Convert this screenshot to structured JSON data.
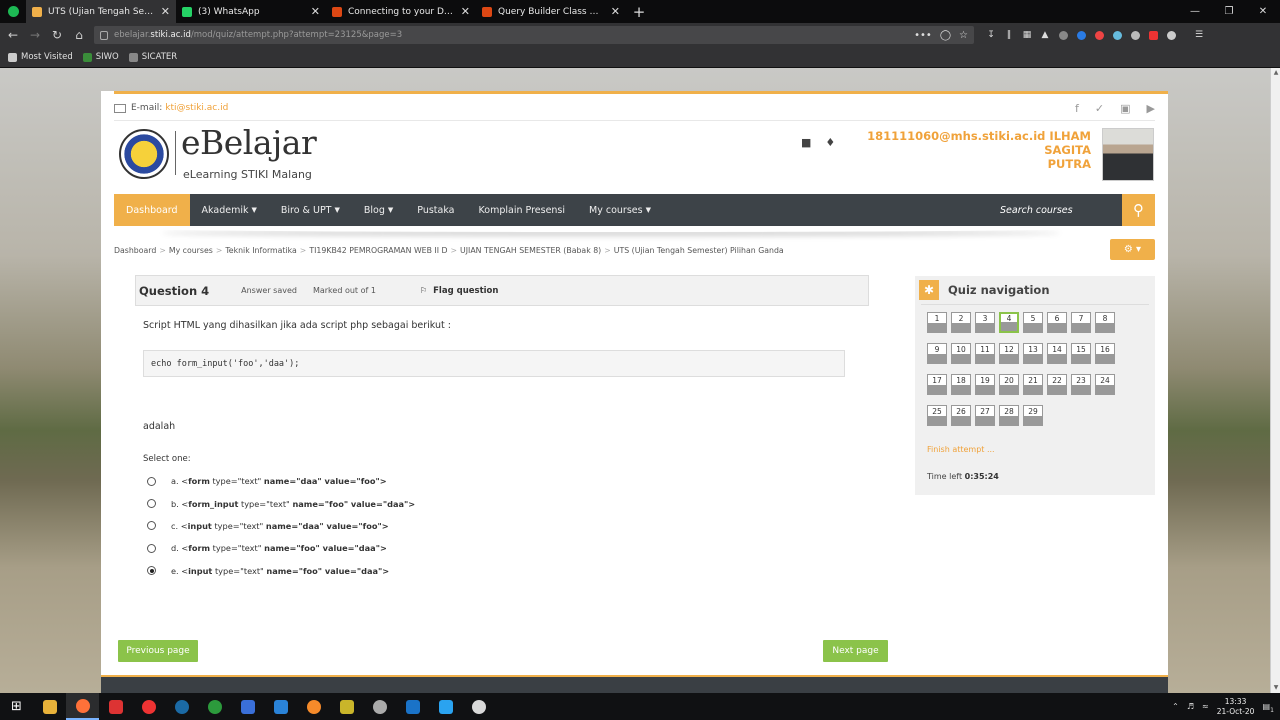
{
  "browser": {
    "tabs": [
      {
        "title": "UTS (Ujian Tengah Semester) Pilihan Ganda",
        "active": true,
        "color": "#f0b04a"
      },
      {
        "title": "(3) WhatsApp",
        "active": false,
        "color": "#25d366"
      },
      {
        "title": "Connecting to your Database - CodeIgniter",
        "active": false,
        "color": "#dd4814"
      },
      {
        "title": "Query Builder Class — CodeIgniter",
        "active": false,
        "color": "#dd4814"
      }
    ],
    "url_prefix": "ebelajar.",
    "url_host": "stiki.ac.id",
    "url_path": "/mod/quiz/attempt.php?attempt=23125&page=3",
    "url_menu": "•••",
    "bookmarks": [
      {
        "label": "Most Visited",
        "icon": "gear-icon"
      },
      {
        "label": "SIWO",
        "icon": "siwo-icon"
      },
      {
        "label": "SICATER",
        "icon": "sicater-icon"
      }
    ]
  },
  "header": {
    "email_label": "E-mail:",
    "email": "kti@stiki.ac.id",
    "brand_title": "eBelajar",
    "brand_subtitle": "eLearning STIKI Malang",
    "user_line1": "181111060@mhs.stiki.ac.id ILHAM SAGITA",
    "user_line2": "PUTRA"
  },
  "nav": {
    "items": [
      {
        "label": "Dashboard",
        "active": true,
        "dropdown": false
      },
      {
        "label": "Akademik",
        "dropdown": true
      },
      {
        "label": "Biro & UPT",
        "dropdown": true
      },
      {
        "label": "Blog",
        "dropdown": true
      },
      {
        "label": "Pustaka",
        "dropdown": false
      },
      {
        "label": "Komplain Presensi",
        "dropdown": false
      },
      {
        "label": "My courses",
        "dropdown": true
      }
    ],
    "search_placeholder": "Search courses"
  },
  "breadcrumb": [
    "Dashboard",
    "My courses",
    "Teknik Informatika",
    "TI19KB42 PEMROGRAMAN WEB II D",
    "UJIAN TENGAH SEMESTER (Babak 8)",
    "UTS (Ujian Tengah Semester) Pilihan Ganda"
  ],
  "question": {
    "number": "Question 4",
    "state": "Answer saved",
    "grade": "Marked out of 1",
    "flag_label": "Flag question",
    "text": "Script HTML yang dihasilkan jika ada script php sebagai berikut :",
    "code": "echo form_input('foo','daa');",
    "text_after": "adalah",
    "select_label": "Select one:",
    "answers": [
      {
        "letter": "a.",
        "tag": "form",
        "type": "type=\"text\"",
        "attrs": "name=\"daa\" value=\"foo\">",
        "selected": false
      },
      {
        "letter": "b.",
        "tag": "form_input",
        "type": "type=\"text\"",
        "attrs": "name=\"foo\" value=\"daa\">",
        "selected": false
      },
      {
        "letter": "c.",
        "tag": "input",
        "type": "type=\"text\"",
        "attrs": "name=\"daa\" value=\"foo\">",
        "selected": false
      },
      {
        "letter": "d.",
        "tag": "form",
        "type": "type=\"text\"",
        "attrs": "name=\"foo\" value=\"daa\">",
        "selected": false
      },
      {
        "letter": "e.",
        "tag": "input",
        "type": "type=\"text\"",
        "attrs": "name=\"foo\" value=\"daa\">",
        "selected": true
      }
    ]
  },
  "buttons": {
    "previous": "Previous page",
    "next": "Next page"
  },
  "quiz_nav": {
    "title": "Quiz navigation",
    "questions": [
      "1",
      "2",
      "3",
      "4",
      "5",
      "6",
      "7",
      "8",
      "9",
      "10",
      "11",
      "12",
      "13",
      "14",
      "15",
      "16",
      "17",
      "18",
      "19",
      "20",
      "21",
      "22",
      "23",
      "24",
      "25",
      "26",
      "27",
      "28",
      "29"
    ],
    "current": "4",
    "finish_label": "Finish attempt ...",
    "time_label": "Time left",
    "time_value": "0:35:24"
  },
  "taskbar": {
    "time": "13:33",
    "date": "21-Oct-20",
    "notif_count": "1"
  },
  "colors": {
    "accent": "#f0b04a",
    "green": "#8bc34a",
    "nav_bg": "#3d4348"
  }
}
